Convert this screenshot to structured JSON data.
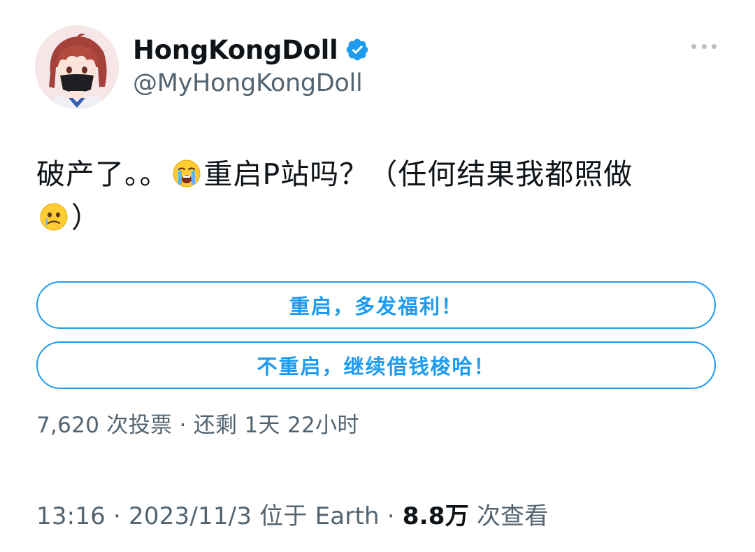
{
  "author": {
    "display_name": "HongKongDoll",
    "handle": "@MyHongKongDoll",
    "verified": true,
    "avatar": "anime-girl-masked-avatar"
  },
  "more_menu": {
    "icon": "more-horizontal-icon"
  },
  "tweet": {
    "text_part1": "破产了。。",
    "emoji1": "loudly-crying-face-emoji",
    "text_part2": "重启P站吗？（任何结果我都照做",
    "emoji2": "face-holding-back-tears-emoji",
    "text_part3": "）"
  },
  "poll": {
    "options": [
      {
        "label": "重启，多发福利！"
      },
      {
        "label": "不重启，继续借钱梭哈！"
      }
    ],
    "meta": "7,620 次投票 · 还剩 1天 22小时"
  },
  "footer": {
    "time": "13:16",
    "sep1": " · ",
    "date": "2023/11/3",
    "location": " 位于 Earth",
    "sep2": " · ",
    "views": "8.8万",
    "views_suffix": " 次查看"
  },
  "colors": {
    "accent": "#1d9bf0",
    "text_primary": "#0f1419",
    "text_secondary": "#536471"
  }
}
